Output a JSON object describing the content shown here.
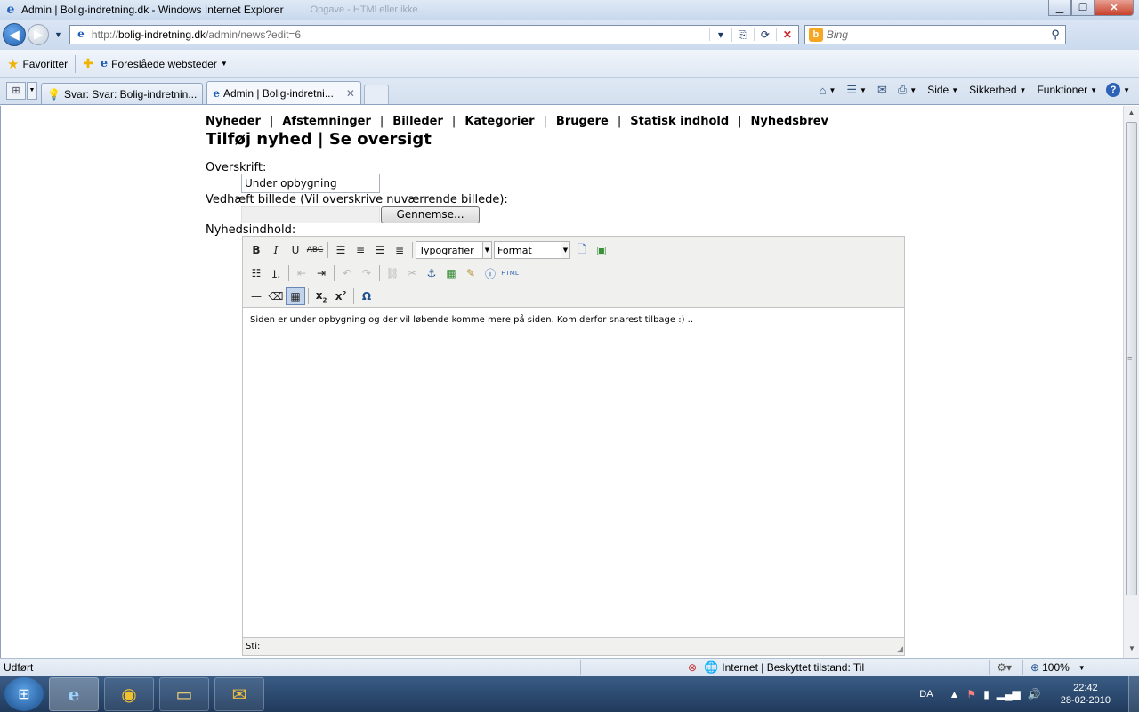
{
  "window": {
    "title": "Admin | Bolig-indretning.dk - Windows Internet Explorer",
    "ghost_title": "Opgave - HTMl eller ikke..."
  },
  "address": {
    "url_prefix": "http://",
    "url_domain": "bolig-indretning.dk",
    "url_path": "/admin/news?edit=6",
    "search_placeholder": "Bing"
  },
  "favorites": {
    "label": "Favoritter",
    "suggested": "Foreslåede websteder"
  },
  "tabs": [
    {
      "label": "Svar: Svar: Bolig-indretnin..."
    },
    {
      "label": "Admin | Bolig-indretni..."
    }
  ],
  "commandbar": {
    "page": "Side",
    "safety": "Sikkerhed",
    "tools": "Funktioner"
  },
  "page": {
    "nav": [
      "Nyheder",
      "Afstemninger",
      "Billeder",
      "Kategorier",
      "Brugere",
      "Statisk indhold",
      "Nyhedsbrev"
    ],
    "nav_sep": "|",
    "heading": "Tilføj nyhed | Se oversigt",
    "headline_label": "Overskrift:",
    "headline_value": "Under opbygning",
    "image_label": "Vedhæft billede (Vil overskrive nuværrende billede):",
    "browse_button": "Gennemse...",
    "content_label": "Nyhedsindhold:"
  },
  "editor": {
    "styles_select": "Typografier",
    "format_select": "Format",
    "content": "Siden er under opbygning og der vil løbende komme mere på siden. Kom derfor snarest tilbage :) ..",
    "path_label": "Sti:",
    "html_button": "HTML"
  },
  "status": {
    "done": "Udført",
    "zone": "Internet | Beskyttet tilstand: Til",
    "zoom": "100%"
  },
  "taskbar": {
    "lang": "DA",
    "time": "22:42",
    "date": "28-02-2010"
  }
}
